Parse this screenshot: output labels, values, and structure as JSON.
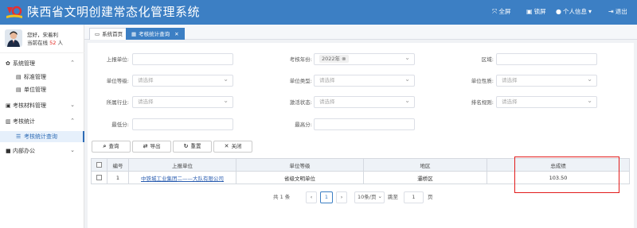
{
  "header": {
    "title": "陕西省文明创建常态化管理系统",
    "fullscreen_label": "全屏",
    "lock_label": "锁屏",
    "profile_label": "个人信息",
    "logout_label": "退出",
    "bg_color": "#3c7fc4"
  },
  "user": {
    "greeting": "您好，宋着利",
    "online_prefix": "当前在线",
    "online_count": "52",
    "online_suffix": "人"
  },
  "sidebar": {
    "groups": [
      {
        "label": "系统管理",
        "icon": "gear-icon",
        "items": [
          "标准管理",
          "单位管理"
        ]
      },
      {
        "label": "考核材料管理",
        "icon": "folder-icon",
        "items": []
      },
      {
        "label": "考核统计",
        "icon": "chart-icon",
        "items": [
          "考核统计查询"
        ]
      },
      {
        "label": "内部办公",
        "icon": "briefcase-icon",
        "items": []
      }
    ]
  },
  "tabs": [
    {
      "label": "系统首页",
      "icon": "monitor-icon"
    },
    {
      "label": "考核统计查询",
      "icon": "table-icon"
    }
  ],
  "filters": {
    "report_unit_label": "上报单位:",
    "report_unit_value": "",
    "year_label": "考核年份:",
    "year_value": "2022年",
    "district_label": "区域:",
    "district_value": "",
    "unit_level_label": "单位等级:",
    "unit_level_placeholder": "请选择",
    "unit_type_label": "单位类型:",
    "unit_type_placeholder": "请选择",
    "unit_nature_label": "单位性质:",
    "unit_nature_placeholder": "请选择",
    "industry_label": "所属行业:",
    "industry_placeholder": "请选择",
    "status_label": "激活状态:",
    "status_placeholder": "请选择",
    "sort_label": "排名规则:",
    "sort_placeholder": "请选择",
    "min_score_label": "最低分:",
    "min_score_value": "",
    "max_score_label": "最高分:",
    "max_score_value": ""
  },
  "buttons": {
    "query": "查询",
    "export": "导出",
    "reset": "重置",
    "close": "关闭"
  },
  "table": {
    "columns": [
      "编号",
      "上报单位",
      "单位等级",
      "地区",
      "总成绩"
    ],
    "rows": [
      {
        "no": "1",
        "unit": "中铁城工业集团二——大队有限公司",
        "level": "省级文明单位",
        "district": "灞桥区",
        "score": "103.50"
      }
    ]
  },
  "pager": {
    "total_prefix": "共",
    "total_count": "1",
    "total_suffix": "条",
    "prev": "‹",
    "current_page": "1",
    "next": "›",
    "page_size": "10条/页",
    "goto_label": "跳至",
    "goto_value": "1",
    "goto_suffix": "页"
  },
  "highlight_color": "#e21b1b"
}
